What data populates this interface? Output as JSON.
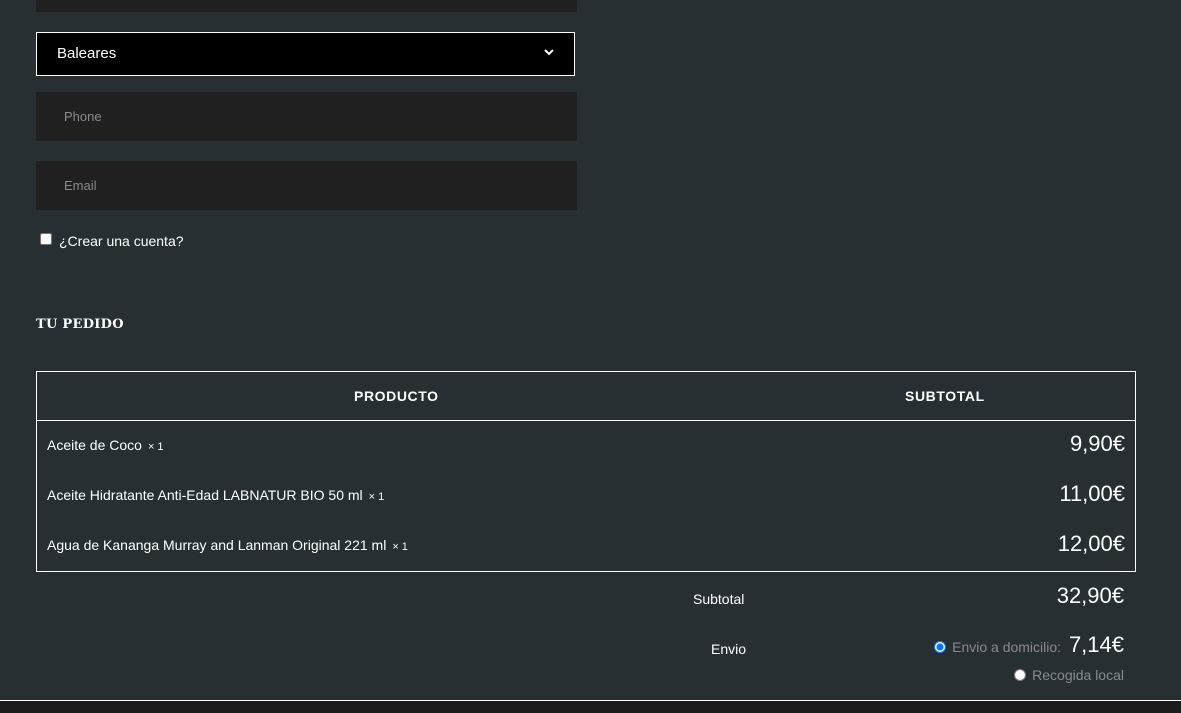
{
  "form": {
    "province_select": {
      "value": "Baleares"
    },
    "phone": {
      "placeholder": "Phone"
    },
    "email": {
      "placeholder": "Email"
    },
    "create_account_label": "¿Crear una cuenta?"
  },
  "order": {
    "title": "TU PEDIDO",
    "columns": {
      "product": "PRODUCTO",
      "subtotal": "SUBTOTAL"
    },
    "items": [
      {
        "name": "Aceite de Coco",
        "qty": "× 1",
        "price": "9,90€"
      },
      {
        "name": "Aceite Hidratante Anti-Edad LABNATUR BIO 50 ml",
        "qty": "× 1",
        "price": "11,00€"
      },
      {
        "name": "Agua de Kananga Murray and Lanman Original 221 ml",
        "qty": "× 1",
        "price": "12,00€"
      }
    ],
    "subtotal": {
      "label": "Subtotal",
      "value": "32,90€"
    },
    "shipping": {
      "label": "Envio",
      "options": [
        {
          "label": "Envio a domicilio:",
          "price": "7,14€",
          "selected": true
        },
        {
          "label": "Recogida local",
          "selected": false
        }
      ]
    }
  },
  "colors": {
    "background": "#272f33",
    "field": "#202020",
    "select_bg": "#000000",
    "text": "#ffffff",
    "muted": "#8a8a8a"
  }
}
